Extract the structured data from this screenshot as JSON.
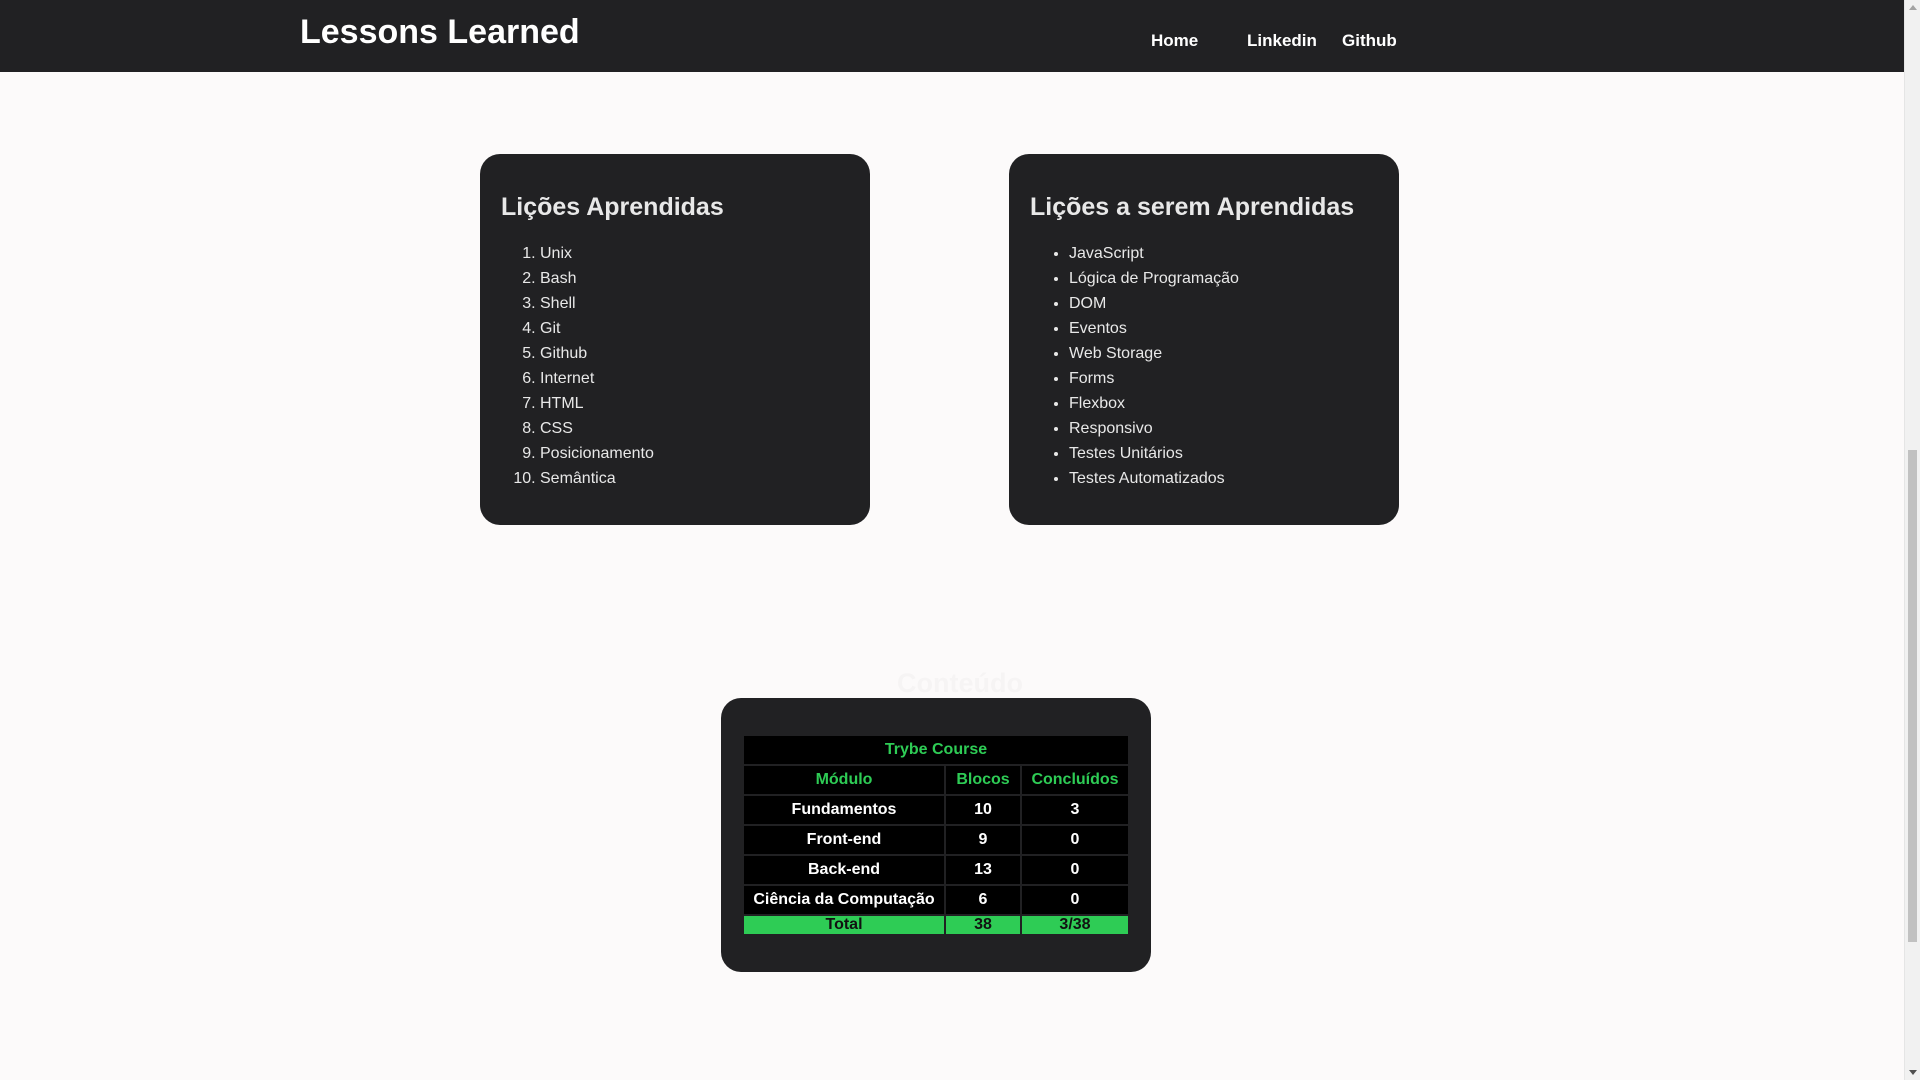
{
  "header": {
    "title": "Lessons Learned",
    "nav": {
      "home": "Home",
      "linkedin": "Linkedin",
      "github": "Github"
    }
  },
  "learned": {
    "title": "Lições Aprendidas",
    "items": [
      "Unix",
      "Bash",
      "Shell",
      "Git",
      "Github",
      "Internet",
      "HTML",
      "CSS",
      "Posicionamento",
      "Semântica"
    ]
  },
  "to_learn": {
    "title": "Lições a serem Aprendidas",
    "items": [
      "JavaScript",
      "Lógica de Programação",
      "DOM",
      "Eventos",
      "Web Storage",
      "Forms",
      "Flexbox",
      "Responsivo",
      "Testes Unitários",
      "Testes Automatizados"
    ]
  },
  "content_section": {
    "heading": "Conteúdo",
    "table": {
      "caption": "Trybe Course",
      "headers": [
        "Módulo",
        "Blocos",
        "Concluídos"
      ],
      "rows": [
        [
          "Fundamentos",
          "10",
          "3"
        ],
        [
          "Front-end",
          "9",
          "0"
        ],
        [
          "Back-end",
          "13",
          "0"
        ],
        [
          "Ciência da Computação",
          "6",
          "0"
        ]
      ],
      "total": [
        "Total",
        "38",
        "3/38"
      ]
    }
  },
  "colors": {
    "header_bg": "#212123",
    "card_bg": "#212123",
    "accent_green": "#2ecc55",
    "page_bg": "#fcfafa"
  }
}
